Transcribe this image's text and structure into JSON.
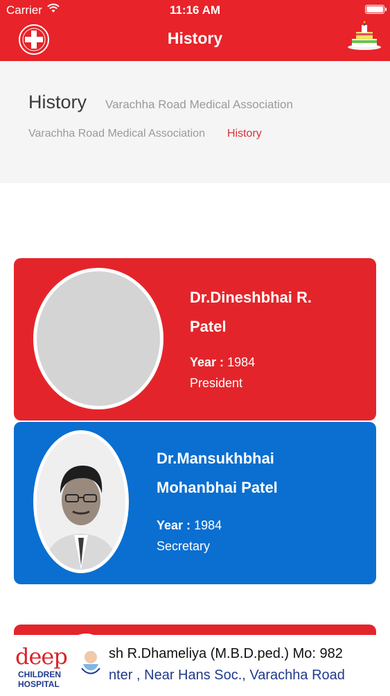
{
  "status_bar": {
    "carrier": "Carrier",
    "time": "11:16 AM"
  },
  "nav": {
    "title": "History",
    "logo_icon": "medical-cross-logo-icon",
    "right_icon": "birthday-cake-icon"
  },
  "header": {
    "title": "History",
    "subtitle": "Varachha Road Medical Association",
    "breadcrumb": [
      {
        "label": "Varachha Road Medical Association"
      },
      {
        "label": "History"
      }
    ]
  },
  "members": [
    {
      "name": "Dr.Dineshbhai R. Patel",
      "year_label": "Year :",
      "year": "1984",
      "role": "President",
      "card_color": "#e3252b"
    },
    {
      "name": "Dr.Mansukhbhai Mohanbhai Patel",
      "year_label": "Year :",
      "year": "1984",
      "role": "Secretary",
      "card_color": "#0a6fd0"
    }
  ],
  "ad": {
    "brand": "deep",
    "brand_line1": "CHILDREN",
    "brand_line2": "HOSPITAL",
    "line1": "sh R.Dhameliya (M.B.D.ped.) Mo: 982",
    "line2": "nter , Near Hans Soc., Varachha Road"
  },
  "colors": {
    "accent_red": "#e8232a",
    "card_blue": "#0a6fd0",
    "breadcrumb_active": "#d93036"
  }
}
